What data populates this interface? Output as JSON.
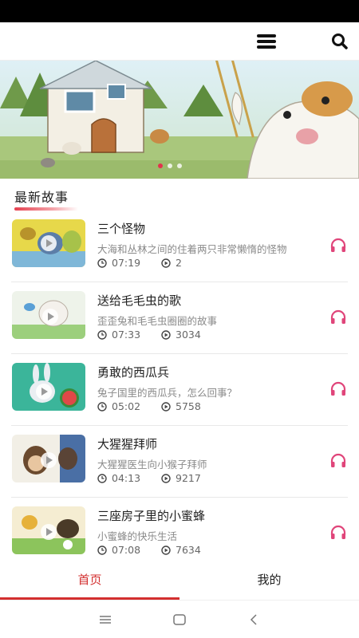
{
  "header": {
    "menu_icon": "hamburger-menu-icon",
    "search_icon": "search-icon"
  },
  "banner": {
    "slides_total": 3,
    "active_slide": 1
  },
  "section": {
    "title": "最新故事"
  },
  "stories": [
    {
      "title": "三个怪物",
      "description": "大海和丛林之间的住着两只非常懒惰的怪物",
      "duration": "07:19",
      "plays": "2"
    },
    {
      "title": "送给毛毛虫的歌",
      "description": "歪歪兔和毛毛虫圈圈的故事",
      "duration": "07:33",
      "plays": "3034"
    },
    {
      "title": "勇敢的西瓜兵",
      "description": "兔子国里的西瓜兵，怎么回事？",
      "duration": "05:02",
      "plays": "5758"
    },
    {
      "title": "大猩猩拜师",
      "description": "大猩猩医生向小猴子拜师",
      "duration": "04:13",
      "plays": "9217"
    },
    {
      "title": "三座房子里的小蜜蜂",
      "description": "小蜜蜂的快乐生活",
      "duration": "07:08",
      "plays": "7634"
    }
  ],
  "tabs": [
    {
      "label": "首页",
      "active": true
    },
    {
      "label": "我的",
      "active": false
    }
  ],
  "colors": {
    "accent": "#d32f2f",
    "listen_icon": "#e0457a"
  }
}
